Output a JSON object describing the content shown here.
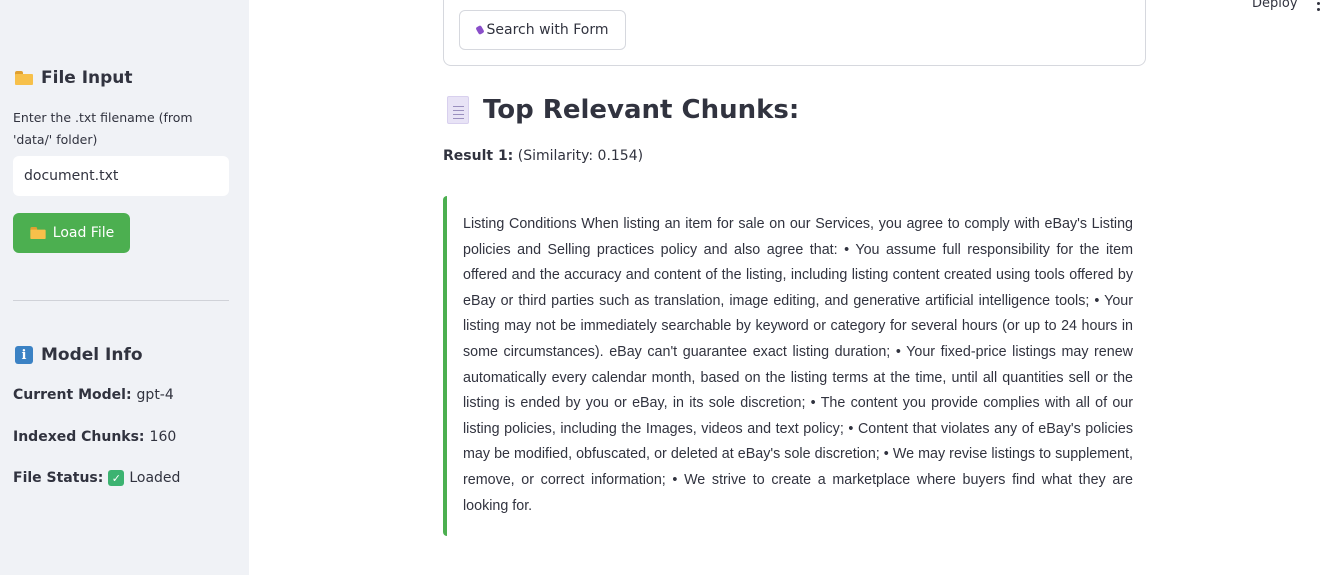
{
  "topbar": {
    "deploy_label": "Deploy",
    "menu_icon": "more-vertical-icon"
  },
  "sidebar": {
    "file_input": {
      "heading": "File Input",
      "icon": "folder-icon",
      "field_label": "Enter the .txt filename (from 'data/' folder)",
      "field_value": "document.txt",
      "load_button_label": "Load File"
    },
    "model_info": {
      "heading": "Model Info",
      "icon": "info-icon",
      "current_model_label": "Current Model:",
      "current_model_value": "gpt-4",
      "indexed_chunks_label": "Indexed Chunks:",
      "indexed_chunks_value": "160",
      "file_status_label": "File Status:",
      "file_status_value": "Loaded"
    }
  },
  "main": {
    "search_button_label": "Search with Form",
    "section_heading": "Top Relevant Chunks:",
    "results": [
      {
        "label": "Result 1:",
        "similarity": "(Similarity: 0.154)",
        "text": "Listing Conditions When listing an item for sale on our Services, you agree to comply with eBay's Listing policies and Selling practices policy and also agree that: • You assume full responsibility for the item offered and the accuracy and content of the listing, including listing content created using tools offered by eBay or third parties such as translation, image editing, and generative artificial intelligence tools; • Your listing may not be immediately searchable by keyword or category for several hours (or up to 24 hours in some circumstances). eBay can't guarantee exact listing duration; • Your fixed-price listings may renew automatically every calendar month, based on the listing terms at the time, until all quantities sell or the listing is ended by you or eBay, in its sole discretion; • The content you provide complies with all of our listing policies, including the Images, videos and text policy; • Content that violates any of eBay's policies may be modified, obfuscated, or deleted at eBay's sole discretion; • We may revise listings to supplement, remove, or correct information; • We strive to create a marketplace where buyers find what they are looking for."
      }
    ]
  },
  "colors": {
    "sidebar_bg": "#f0f2f6",
    "accent_green": "#4caf50",
    "text": "#31333f"
  }
}
